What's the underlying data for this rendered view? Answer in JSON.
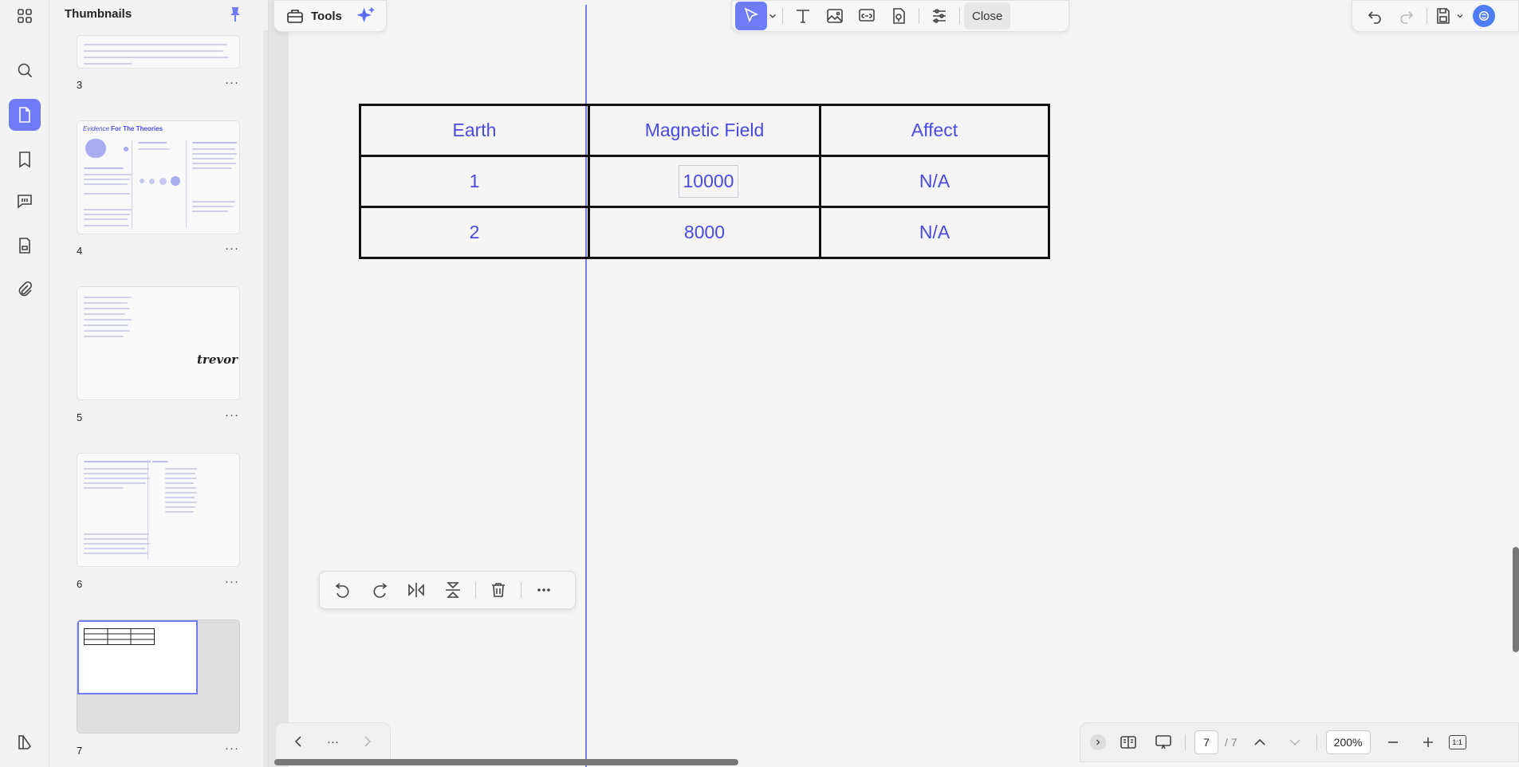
{
  "thumbnails_panel": {
    "title": "Thumbnails",
    "pages": [
      {
        "number": "3",
        "more": "···"
      },
      {
        "number": "4",
        "more": "···",
        "heading_italic": "Evidence",
        "heading_bold": "For The Theories"
      },
      {
        "number": "5",
        "more": "···",
        "signature": "trevor"
      },
      {
        "number": "6",
        "more": "···"
      },
      {
        "number": "7",
        "more": "···"
      }
    ]
  },
  "toolbar": {
    "tools_label": "Tools",
    "close_label": "Close"
  },
  "table": {
    "headers": [
      "Earth",
      "Magnetic Field",
      "Affect"
    ],
    "rows": [
      [
        "1",
        "10000",
        "N/A"
      ],
      [
        "2",
        "8000",
        "N/A"
      ]
    ]
  },
  "navigation": {
    "more": "···"
  },
  "status": {
    "current_page": "7",
    "total_pages": "/ 7",
    "zoom": "200%",
    "fit_label": "1:1"
  },
  "colors": {
    "accent": "#6f7cf6",
    "table_text": "#4a4ae0"
  }
}
